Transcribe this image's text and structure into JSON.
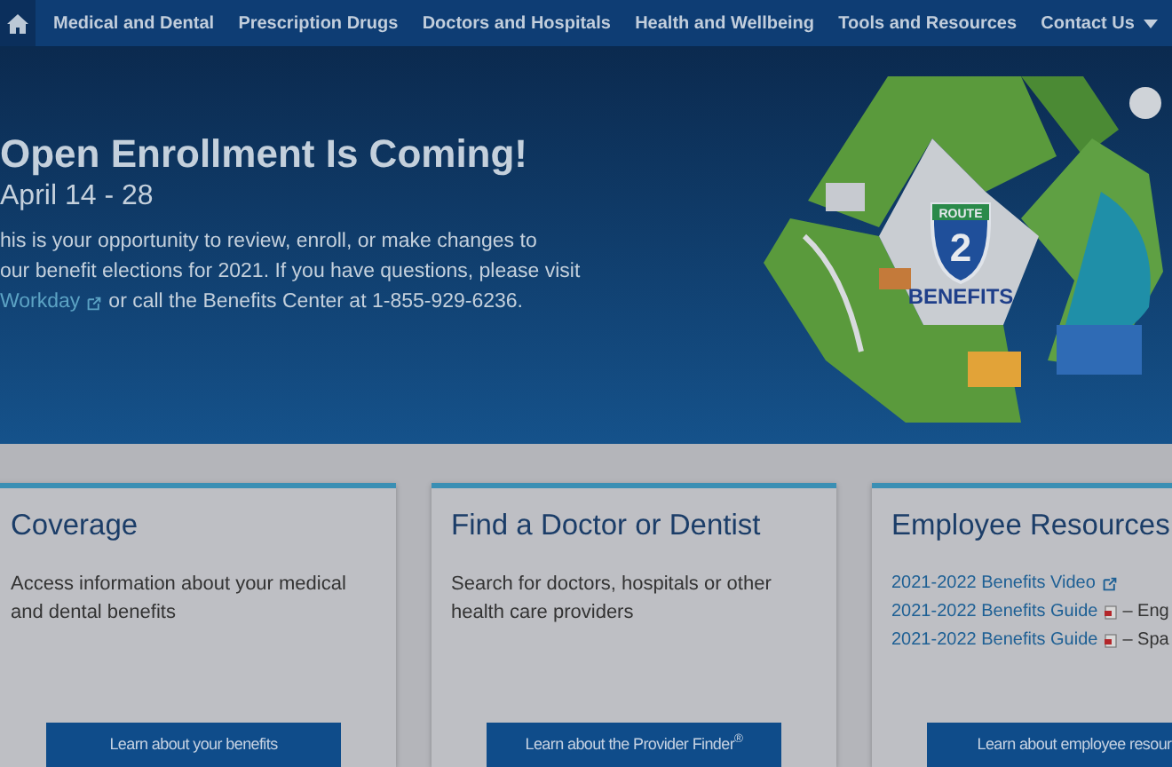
{
  "nav": {
    "items": [
      {
        "label": "Medical and Dental",
        "has_caret": false
      },
      {
        "label": "Prescription Drugs",
        "has_caret": false
      },
      {
        "label": "Doctors and Hospitals",
        "has_caret": false
      },
      {
        "label": "Health and Wellbeing",
        "has_caret": false
      },
      {
        "label": "Tools and Resources",
        "has_caret": false
      },
      {
        "label": "Contact Us",
        "has_caret": true
      }
    ]
  },
  "hero": {
    "title": "Open Enrollment Is Coming!",
    "dates": "April 14 - 28",
    "lines": [
      "his is your opportunity to review, enroll, or make changes to",
      "our benefit elections for 2021. If you have questions, please visit"
    ],
    "link": "Workday",
    "after_link": "or call the Benefits Center at 1-855-929-6236.",
    "illustration": {
      "shield_top": "ROUTE",
      "shield_number": "2",
      "caption": "BENEFITS"
    }
  },
  "cards": [
    {
      "title": "Coverage",
      "text": "Access information about your medical and dental benefits",
      "button": "Learn about your benefits"
    },
    {
      "title": "Find a Doctor or Dentist",
      "text": "Search for doctors, hospitals or other health care providers",
      "button": "Learn about the Provider Finder$^{®}$"
    },
    {
      "title": "Employee Resources",
      "links": [
        {
          "label": "2021-2022 Benefits Video",
          "kind": "external"
        },
        {
          "label": "2021-2022 Benefits Guide",
          "kind": "pdf",
          "suffix": "– Eng"
        },
        {
          "label": "2021-2022 Benefits Guide",
          "kind": "pdf",
          "suffix": "– Spa"
        }
      ],
      "button": "Learn about employee resour"
    }
  ]
}
